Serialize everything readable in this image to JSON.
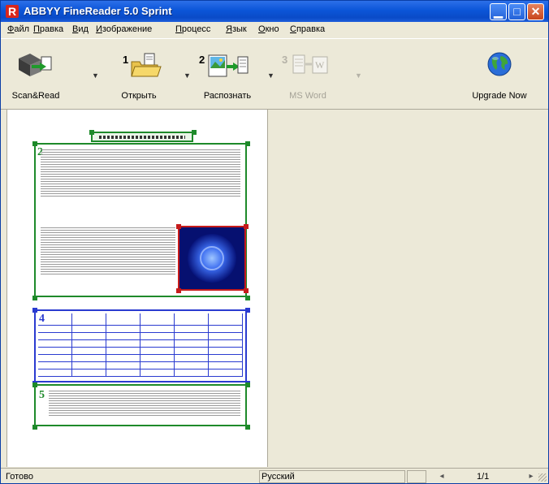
{
  "window": {
    "title": "ABBYY FineReader 5.0 Sprint",
    "app_icon_glyph": "R"
  },
  "menu": {
    "items": [
      {
        "accel": "Ф",
        "rest": "айл"
      },
      {
        "accel": "П",
        "rest": "равка"
      },
      {
        "accel": "В",
        "rest": "ид"
      },
      {
        "accel": "И",
        "rest": "зображение"
      },
      {
        "accel": "П",
        "rest": "роцесс"
      },
      {
        "accel": "Я",
        "rest": "зык"
      },
      {
        "accel": "О",
        "rest": "кно"
      },
      {
        "accel": "С",
        "rest": "правка"
      }
    ]
  },
  "toolbar": {
    "scan_read_label": "Scan&Read",
    "open_label": "Открыть",
    "open_step": "1",
    "recognize_label": "Распознать",
    "recognize_step": "2",
    "msword_label": "MS Word",
    "msword_step": "3",
    "upgrade_label": "Upgrade Now"
  },
  "page": {
    "heading_block_label": "",
    "block_numbers": {
      "text_block_1": "2",
      "table_block": "4",
      "text_block_2": "5"
    }
  },
  "statusbar": {
    "status": "Готово",
    "language": "Русский",
    "page_counter": "1/1"
  },
  "colors": {
    "text_block": "#1e8a2a",
    "picture_block": "#c61b1b",
    "table_block": "#2a3bd0",
    "titlebar": "#0b55d8"
  },
  "icons": {
    "scan_read": "scanner-icon",
    "open": "folder-open-icon",
    "recognize": "recognize-icon",
    "msword": "msword-icon",
    "upgrade": "globe-icon"
  }
}
